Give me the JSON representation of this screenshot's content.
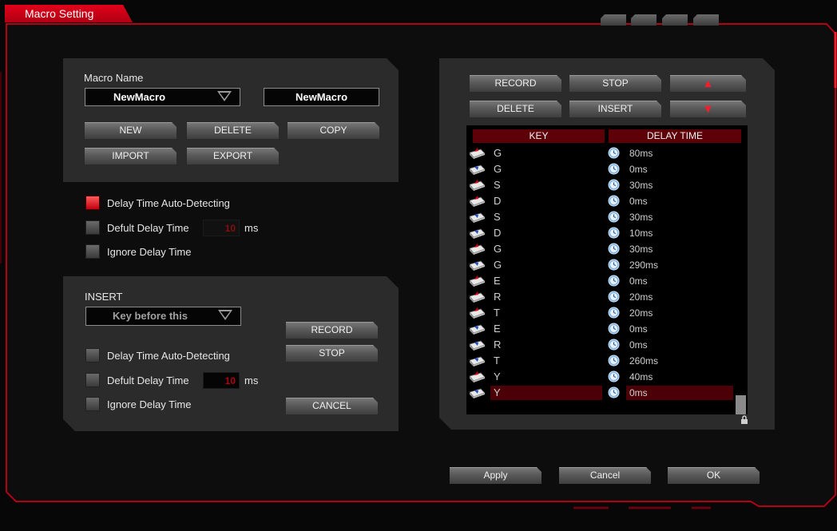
{
  "window": {
    "title": "Macro Setting"
  },
  "macro_name": {
    "label": "Macro Name",
    "selected": "NewMacro",
    "name_value": "NewMacro",
    "buttons": {
      "new": "NEW",
      "delete": "DELETE",
      "copy": "COPY",
      "import": "IMPORT",
      "export": "EXPORT"
    }
  },
  "record_options": {
    "auto_detect_label": "Delay Time Auto-Detecting",
    "auto_detect_checked": true,
    "default_delay_label": "Defult Delay Time",
    "default_delay_checked": false,
    "default_delay_value": "10",
    "unit": "ms",
    "ignore_label": "Ignore Delay Time",
    "ignore_checked": false
  },
  "insert": {
    "label": "INSERT",
    "position_selected": "Key before this",
    "auto_detect_label": "Delay Time Auto-Detecting",
    "default_delay_label": "Defult Delay Time",
    "default_delay_value": "10",
    "unit": "ms",
    "ignore_label": "Ignore Delay Time",
    "buttons": {
      "record": "RECORD",
      "stop": "STOP",
      "cancel": "CANCEL"
    }
  },
  "list_toolbar": {
    "record": "RECORD",
    "stop": "STOP",
    "delete": "DELETE",
    "insert": "INSERT",
    "move_up": "▲",
    "move_down": "▼"
  },
  "list": {
    "headers": {
      "key": "KEY",
      "delay": "DELAY TIME"
    },
    "rows": [
      {
        "key": "G",
        "delay": "80ms",
        "action": "press"
      },
      {
        "key": "G",
        "delay": "0ms",
        "action": "release"
      },
      {
        "key": "S",
        "delay": "30ms",
        "action": "press"
      },
      {
        "key": "D",
        "delay": "0ms",
        "action": "press"
      },
      {
        "key": "S",
        "delay": "30ms",
        "action": "release"
      },
      {
        "key": "D",
        "delay": "10ms",
        "action": "release"
      },
      {
        "key": "G",
        "delay": "30ms",
        "action": "press"
      },
      {
        "key": "G",
        "delay": "290ms",
        "action": "release"
      },
      {
        "key": "E",
        "delay": "0ms",
        "action": "press"
      },
      {
        "key": "R",
        "delay": "20ms",
        "action": "press"
      },
      {
        "key": "T",
        "delay": "20ms",
        "action": "press"
      },
      {
        "key": "E",
        "delay": "0ms",
        "action": "release"
      },
      {
        "key": "R",
        "delay": "0ms",
        "action": "release"
      },
      {
        "key": "T",
        "delay": "260ms",
        "action": "release"
      },
      {
        "key": "Y",
        "delay": "40ms",
        "action": "press"
      },
      {
        "key": "Y",
        "delay": "0ms",
        "action": "release",
        "selected": true
      }
    ]
  },
  "footer": {
    "apply": "Apply",
    "cancel": "Cancel",
    "ok": "OK"
  },
  "colors": {
    "accent": "#e2001a",
    "panel": "#2b2b2b",
    "header_bg": "#5e0008",
    "selected_row": "#4a0006"
  },
  "icons": {
    "press": "key-press-icon",
    "release": "key-release-icon",
    "delay": "clock-icon",
    "lock": "lock-icon"
  }
}
